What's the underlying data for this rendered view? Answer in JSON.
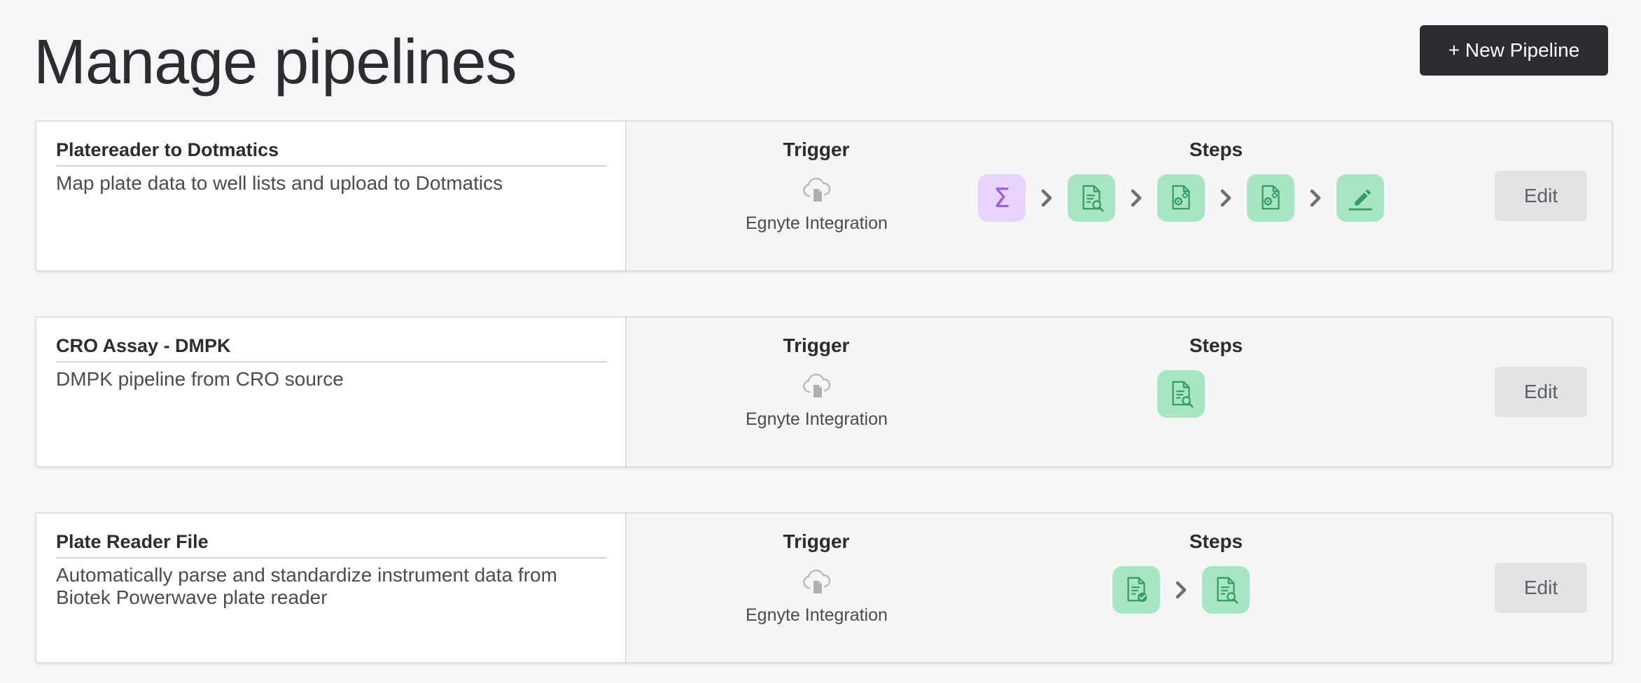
{
  "page": {
    "title": "Manage pipelines",
    "new_button": "+ New Pipeline"
  },
  "labels": {
    "trigger": "Trigger",
    "steps": "Steps",
    "edit": "Edit"
  },
  "colors": {
    "step_green": "#a6e7c2",
    "step_icon_green": "#3a9a64",
    "step_purple": "#e7d4fb",
    "step_icon_purple": "#9a5ee8",
    "arrow": "#6b6f76"
  },
  "pipelines": [
    {
      "name": "Platereader to Dotmatics",
      "description": "Map plate data to well lists and upload to Dotmatics",
      "trigger": {
        "name": "Egnyte Integration",
        "icon": "cloud-upload-icon"
      },
      "steps": [
        "sigma-icon",
        "document-search-icon",
        "document-gear-icon",
        "document-gear-icon",
        "pencil-icon"
      ]
    },
    {
      "name": "CRO Assay - DMPK",
      "description": "DMPK pipeline from CRO source",
      "trigger": {
        "name": "Egnyte Integration",
        "icon": "cloud-upload-icon"
      },
      "steps": [
        "document-search-icon"
      ]
    },
    {
      "name": "Plate Reader File",
      "description": "Automatically parse and standardize instrument data from Biotek Powerwave plate reader",
      "trigger": {
        "name": "Egnyte Integration",
        "icon": "cloud-upload-icon"
      },
      "steps": [
        "document-check-icon",
        "document-search-icon"
      ]
    }
  ]
}
